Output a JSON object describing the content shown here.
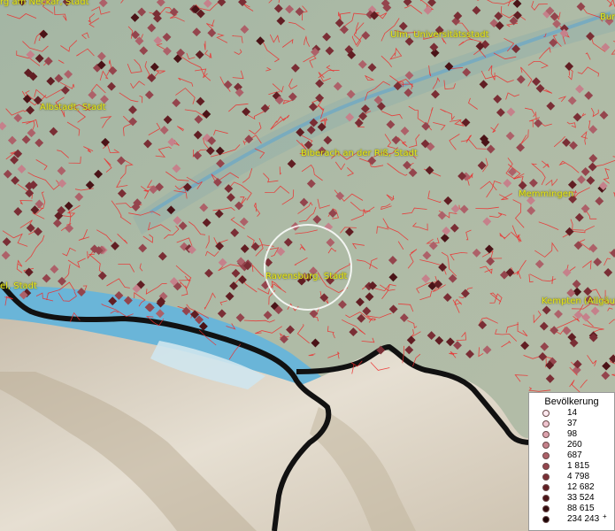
{
  "map": {
    "cities": [
      {
        "id": "heilbronn",
        "label": "rg am Neckar, Stadt"
      },
      {
        "id": "ulm",
        "label": "Ulm, Universitätsstadt"
      },
      {
        "id": "albstadt",
        "label": "Albstadt, Stadt"
      },
      {
        "id": "biberach",
        "label": "Biberach an der Riß, Stadt"
      },
      {
        "id": "memmingen",
        "label": "Memmingen"
      },
      {
        "id": "ravensburg",
        "label": "Ravensburg, Stadt"
      },
      {
        "id": "kempten",
        "label": "Kempten (Allgäu)"
      },
      {
        "id": "edge-left",
        "label": "el, Stadt"
      },
      {
        "id": "edge-right",
        "label": "Bur"
      }
    ],
    "colors": {
      "boundary": "#ee2a2a",
      "lake": "#5fb3d6",
      "terrain": "#a9b8a5",
      "alps": "#d8d0c0",
      "border": "#111111"
    }
  },
  "legend": {
    "title": "Bevölkerung",
    "plus_marker": "+",
    "items": [
      {
        "value": "14",
        "color": "#fbe8ef"
      },
      {
        "value": "37",
        "color": "#efc4cf"
      },
      {
        "value": "98",
        "color": "#dca2ad"
      },
      {
        "value": "260",
        "color": "#c5818b"
      },
      {
        "value": "687",
        "color": "#ad6169"
      },
      {
        "value": "1 815",
        "color": "#94454d"
      },
      {
        "value": "4 798",
        "color": "#7a2e35"
      },
      {
        "value": "12 682",
        "color": "#611e23"
      },
      {
        "value": "33 524",
        "color": "#4a1317"
      },
      {
        "value": "88 615",
        "color": "#330b0e"
      },
      {
        "value": "234 243",
        "color": "#1d0406"
      }
    ]
  }
}
